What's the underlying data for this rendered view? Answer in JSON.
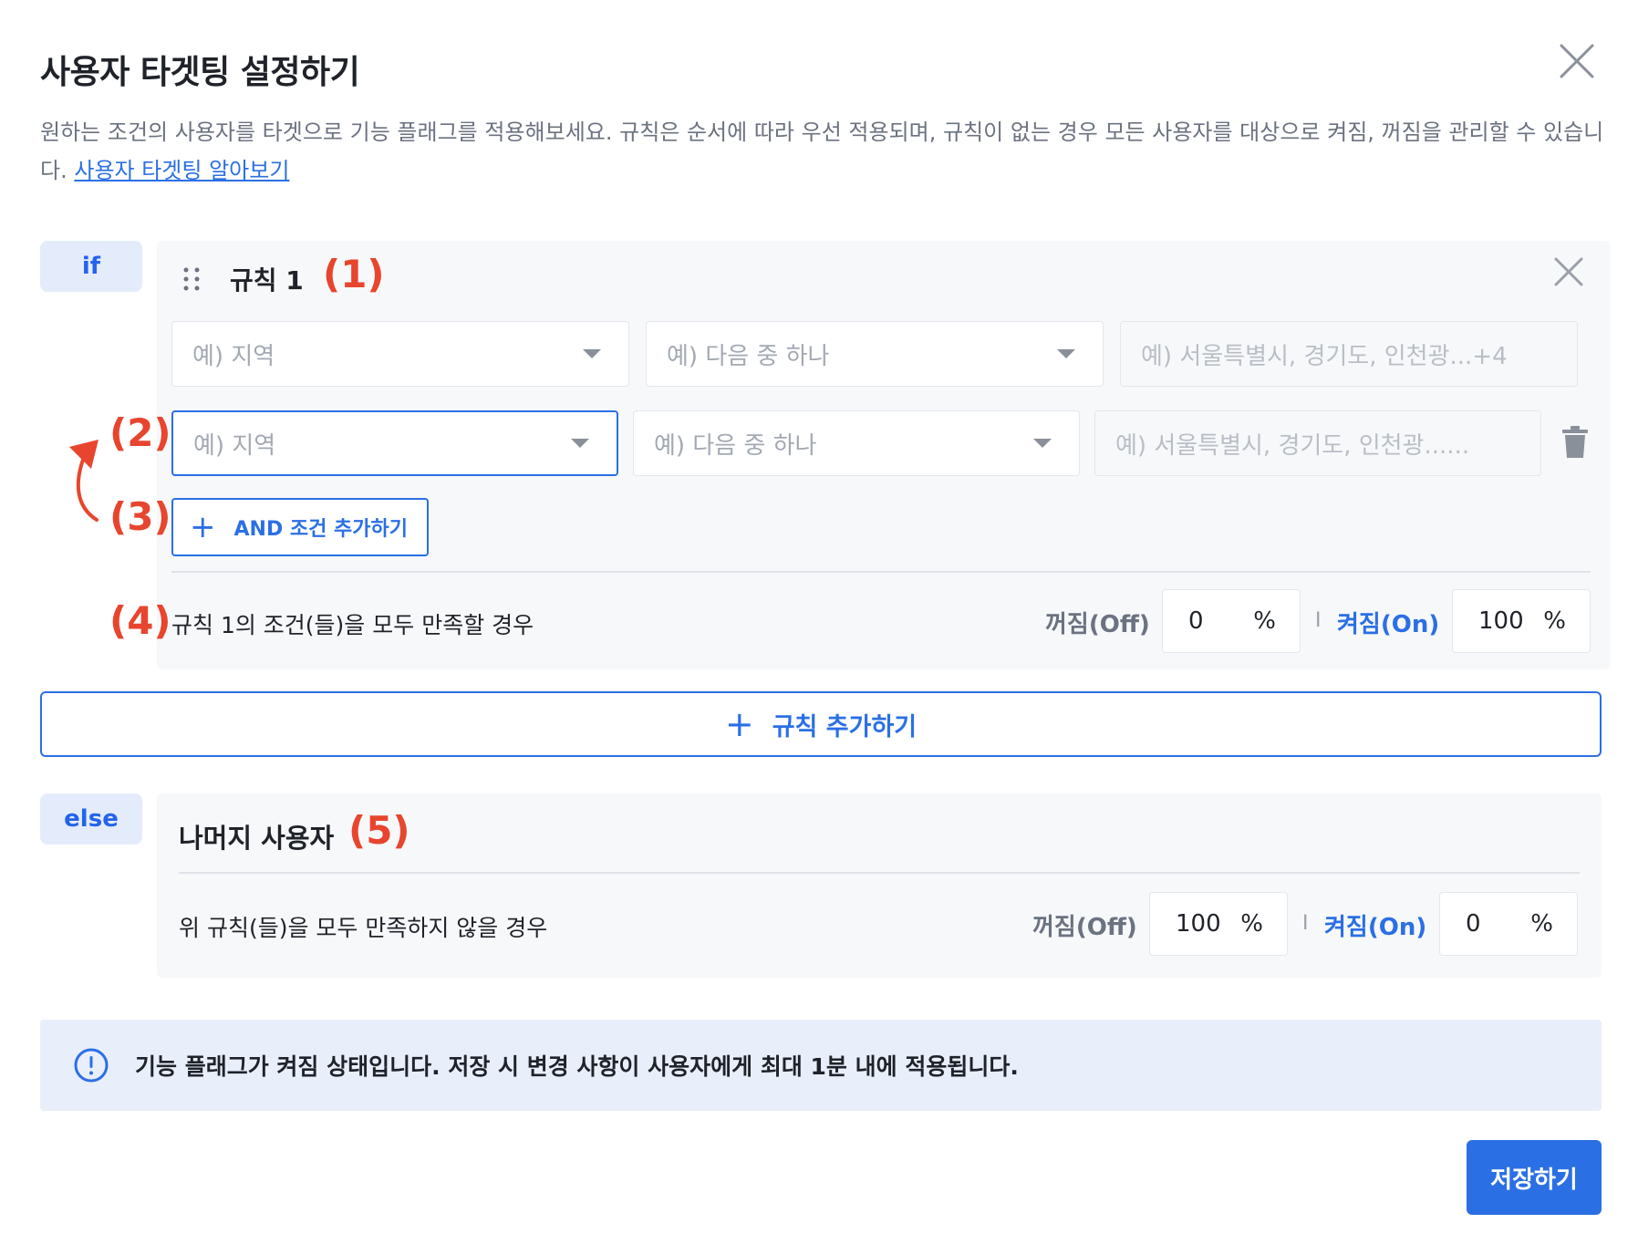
{
  "modal": {
    "title": "사용자 타겟팅 설정하기",
    "description": "원하는 조건의 사용자를 타겟으로 기능 플래그를 적용해보세요. 규칙은 순서에 따라 우선 적용되며, 규칙이 없는 경우 모든 사용자를 대상으로 켜짐, 꺼짐을 관리할 수 있습니다.",
    "learn_more_link": "사용자 타겟팅 알아보기"
  },
  "if_block": {
    "tag": "if",
    "rule_title": "규칙 1",
    "conditions": [
      {
        "attribute_placeholder": "예) 지역",
        "operator_placeholder": "예) 다음 중 하나",
        "values_placeholder": "예) 서울특별시, 경기도, 인천광...+4"
      },
      {
        "attribute_placeholder": "예) 지역",
        "operator_placeholder": "예) 다음 중 하나",
        "values_placeholder": "예) 서울특별시, 경기도, 인천광......"
      }
    ],
    "add_and_label": "AND 조건 추가하기",
    "condition_summary": "규칙 1의 조건(들)을 모두 만족할 경우",
    "off_label": "꺼짐(Off)",
    "off_value": "0",
    "on_label": "켜짐(On)",
    "on_value": "100",
    "percent_unit": "%",
    "separator": "I"
  },
  "add_rule_label": "규칙 추가하기",
  "else_block": {
    "tag": "else",
    "title": "나머지 사용자",
    "condition_summary": "위 규칙(들)을 모두 만족하지 않을 경우",
    "off_label": "꺼짐(Off)",
    "off_value": "100",
    "on_label": "켜짐(On)",
    "on_value": "0",
    "percent_unit": "%",
    "separator": "I"
  },
  "annotations": [
    "(1)",
    "(2)",
    "(3)",
    "(4)",
    "(5)"
  ],
  "info_message": "기능 플래그가 켜짐 상태입니다. 저장 시 변경 사항이 사용자에게 최대 1분 내에 적용됩니다.",
  "save_label": "저장하기",
  "icons": {
    "close": "close-icon",
    "drag": "drag-handle-icon",
    "delete": "trash-icon",
    "info": "info-circle-icon",
    "dropdown": "chevron-down-icon"
  },
  "colors": {
    "accent": "#2b6fe5",
    "annotation": "#e8452e",
    "panel": "#f7f8fa",
    "info_bg": "#e9eefb"
  }
}
